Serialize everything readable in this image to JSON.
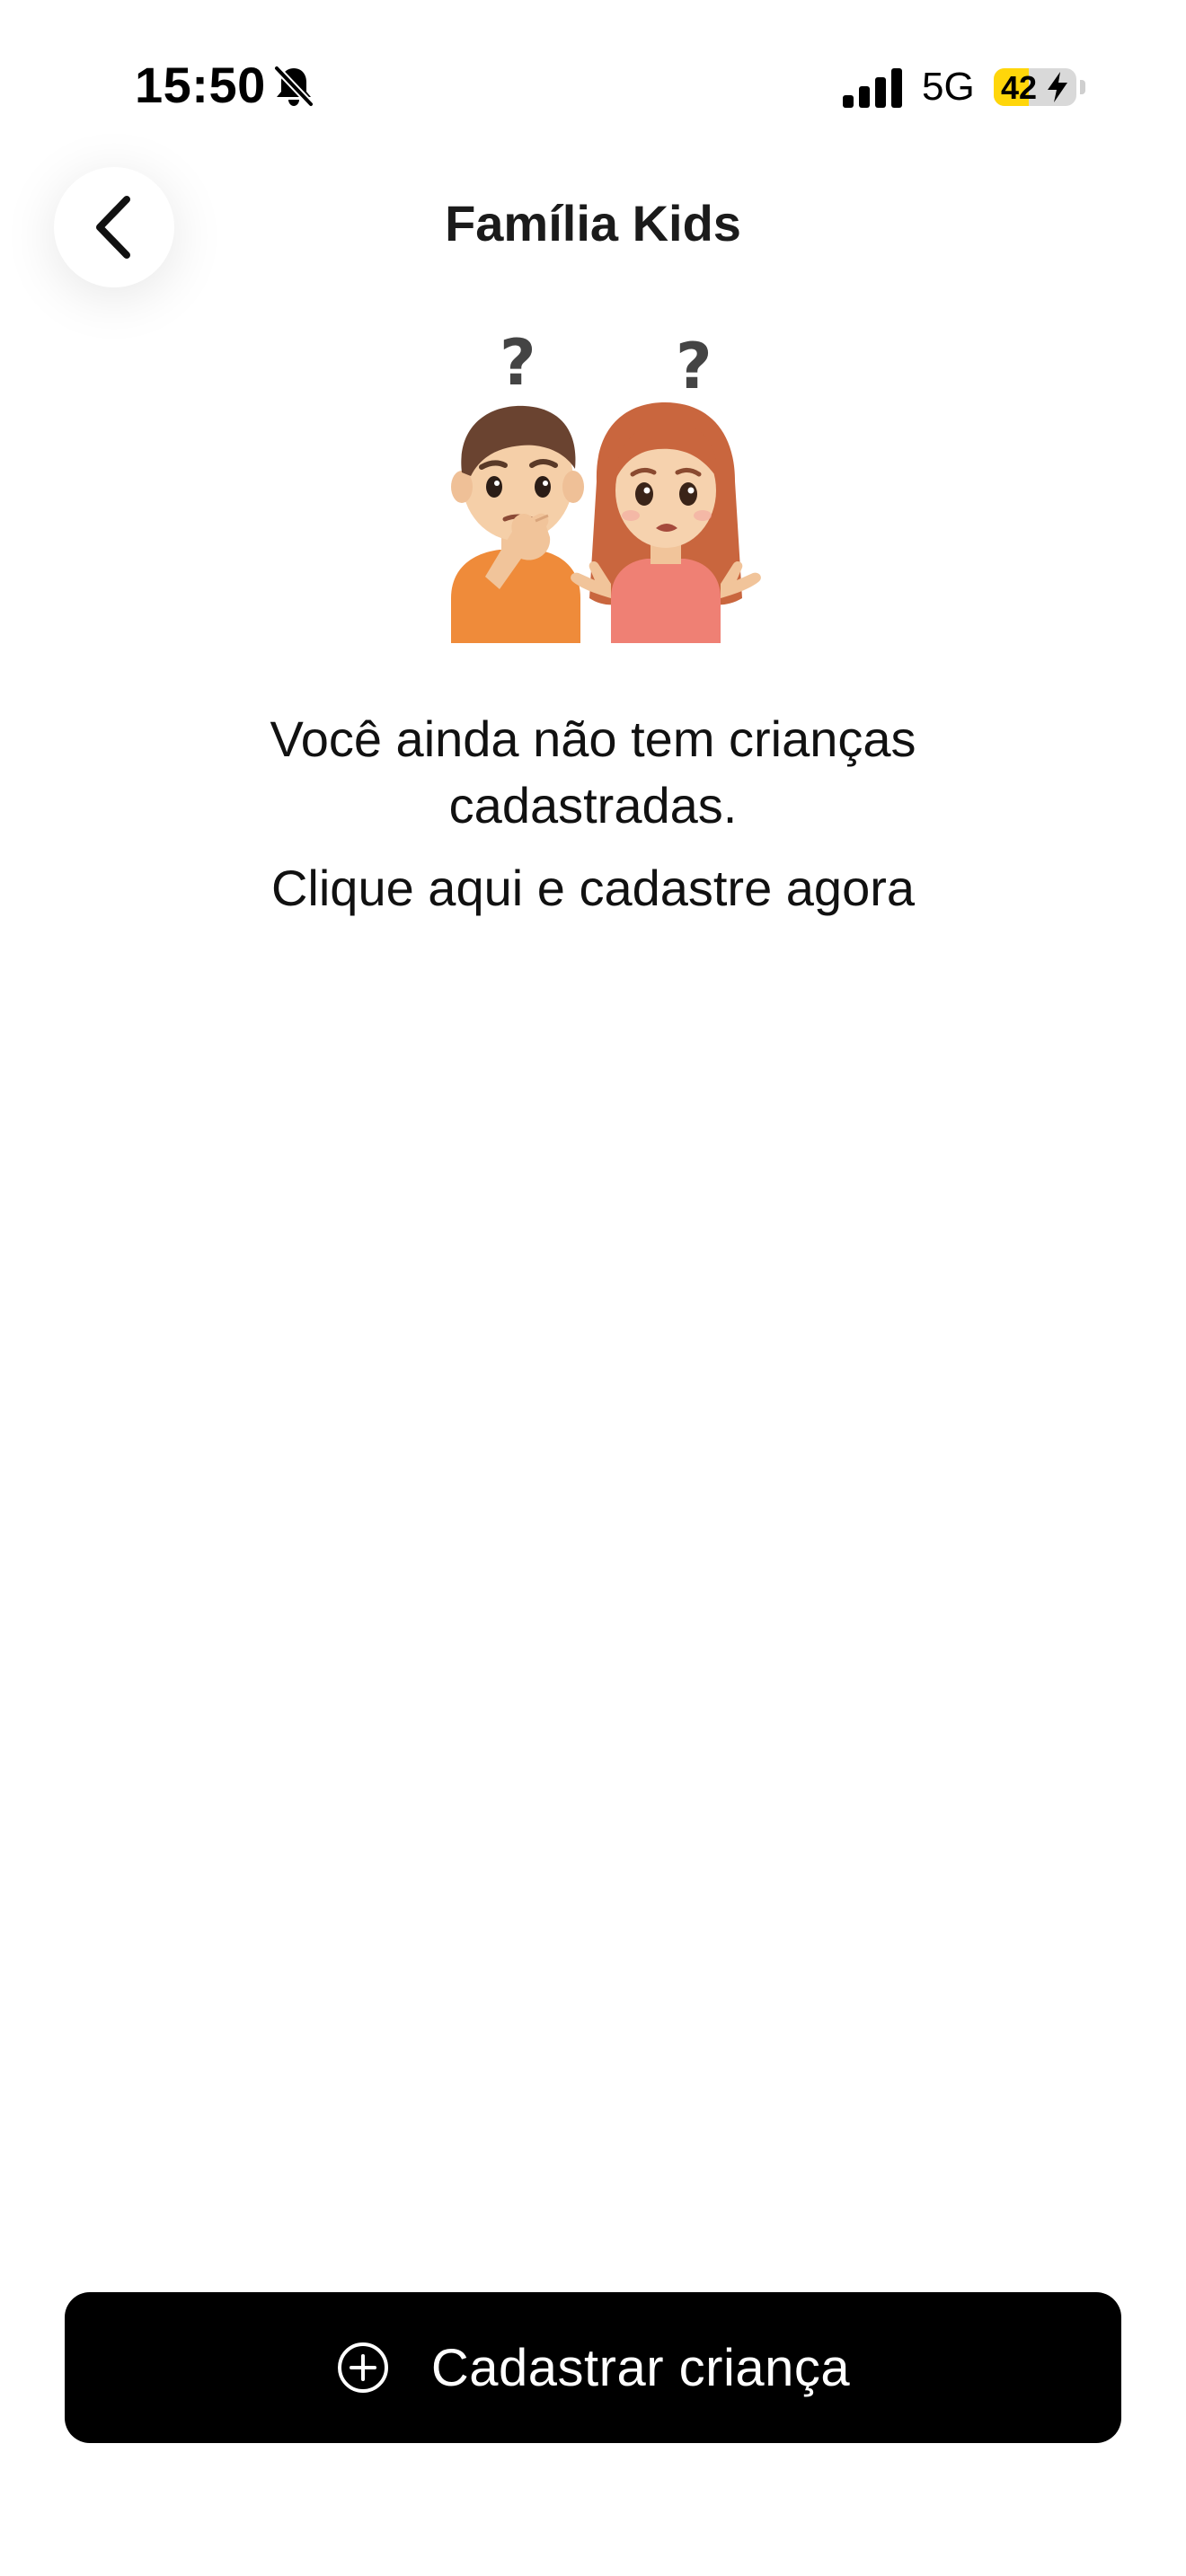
{
  "status_bar": {
    "time": "15:50",
    "network": "5G",
    "battery_level": 42,
    "battery_label": "42",
    "silent_mode": true,
    "charging": true
  },
  "header": {
    "title": "Família Kids",
    "back_icon": "chevron-left-icon"
  },
  "illustration": {
    "icon": "confused-kids-illustration",
    "question_marks": [
      "?",
      "?"
    ]
  },
  "empty_state": {
    "message": "Você ainda não tem crianças cadastradas.",
    "link": "Clique aqui e cadastre agora"
  },
  "primary_action": {
    "icon": "plus-circle-icon",
    "label": "Cadastrar criança"
  },
  "colors": {
    "background": "#ffffff",
    "button_bg": "#000000",
    "button_text": "#ffffff",
    "battery_fill": "#ffd60a"
  }
}
